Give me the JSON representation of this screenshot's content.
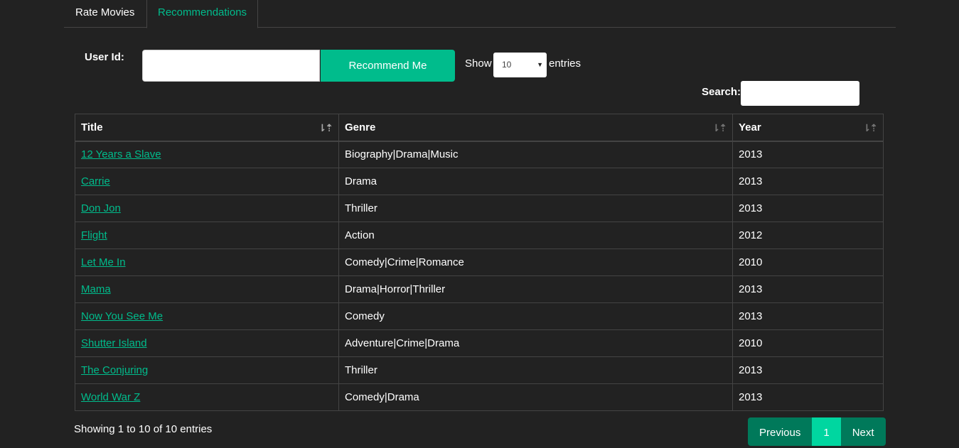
{
  "tabs": [
    {
      "label": "Rate Movies"
    },
    {
      "label": "Recommendations"
    }
  ],
  "form": {
    "user_label": "User Id:",
    "user_value": "",
    "button_label": "Recommend Me"
  },
  "length": {
    "show_label": "Show",
    "selected": "10",
    "entries_label": "entries"
  },
  "search": {
    "label": "Search:",
    "value": ""
  },
  "table": {
    "headers": [
      "Title",
      "Genre",
      "Year"
    ],
    "rows": [
      {
        "title": "12 Years a Slave",
        "genre": "Biography|Drama|Music",
        "year": "2013"
      },
      {
        "title": "Carrie",
        "genre": "Drama",
        "year": "2013"
      },
      {
        "title": "Don Jon",
        "genre": "Thriller",
        "year": "2013"
      },
      {
        "title": "Flight",
        "genre": "Action",
        "year": "2012"
      },
      {
        "title": "Let Me In",
        "genre": "Comedy|Crime|Romance",
        "year": "2010"
      },
      {
        "title": "Mama",
        "genre": "Drama|Horror|Thriller",
        "year": "2013"
      },
      {
        "title": "Now You See Me",
        "genre": "Comedy",
        "year": "2013"
      },
      {
        "title": "Shutter Island",
        "genre": "Adventure|Crime|Drama",
        "year": "2010"
      },
      {
        "title": "The Conjuring",
        "genre": "Thriller",
        "year": "2013"
      },
      {
        "title": "World War Z",
        "genre": "Comedy|Drama",
        "year": "2013"
      }
    ]
  },
  "info": "Showing 1 to 10 of 10 entries",
  "pagination": {
    "previous": "Previous",
    "current": "1",
    "next": "Next"
  },
  "colors": {
    "accent": "#00bc8c",
    "background": "#222222",
    "pager_bg": "#00795a",
    "pager_active": "#00d6a0"
  }
}
